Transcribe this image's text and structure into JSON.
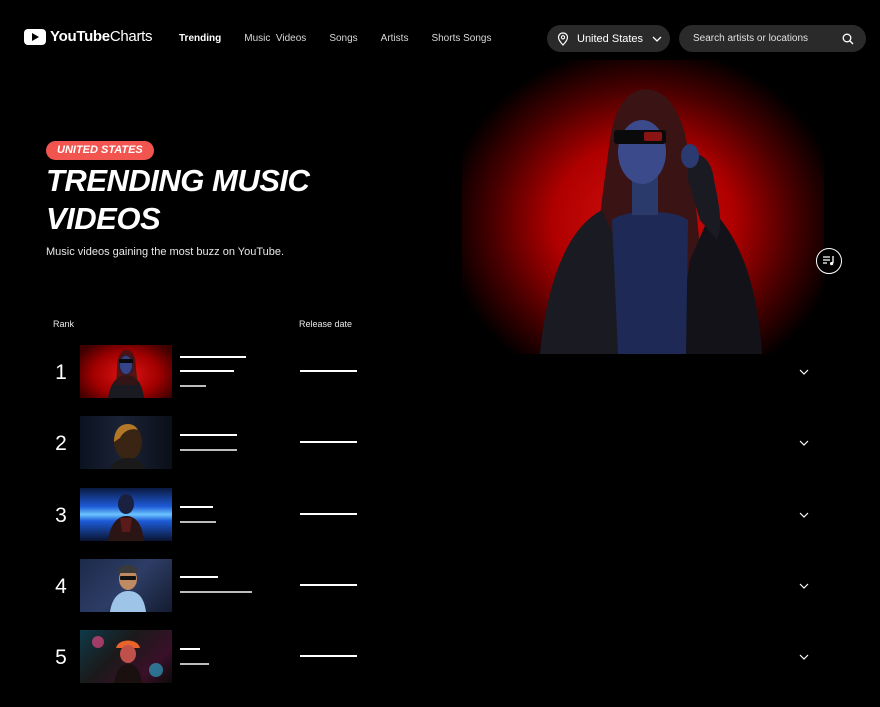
{
  "brand": {
    "name_bold": "YouTube",
    "name_light": "Charts"
  },
  "nav": {
    "items": [
      {
        "label": "Trending",
        "active": true
      },
      {
        "label": "Music  Videos",
        "active": false
      },
      {
        "label": "Songs",
        "active": false
      },
      {
        "label": "Artists",
        "active": false
      },
      {
        "label": "Shorts Songs",
        "active": false
      }
    ]
  },
  "country_select": {
    "value": "United States",
    "icon": "location-pin-icon"
  },
  "search": {
    "placeholder": "Search artists or locations",
    "icon": "search-icon"
  },
  "hero": {
    "badge": "UNITED STATES",
    "title": "TRENDING MUSIC VIDEOS",
    "subtitle": "Music videos gaining the most buzz on YouTube.",
    "playlist_icon": "playlist-icon"
  },
  "table": {
    "headers": {
      "rank": "Rank",
      "release": "Release date"
    },
    "rows": [
      {
        "rank": "1",
        "thumb": "red-neon-portrait"
      },
      {
        "rank": "2",
        "thumb": "dark-portrait"
      },
      {
        "rank": "3",
        "thumb": "blue-neon-portrait"
      },
      {
        "rank": "4",
        "thumb": "sunglasses-portrait"
      },
      {
        "rank": "5",
        "thumb": "neon-city-portrait"
      }
    ],
    "expand_icon": "chevron-down-icon"
  },
  "colors": {
    "accent": "#f2554f",
    "background": "#000000",
    "pill": "#2a2a2a"
  }
}
